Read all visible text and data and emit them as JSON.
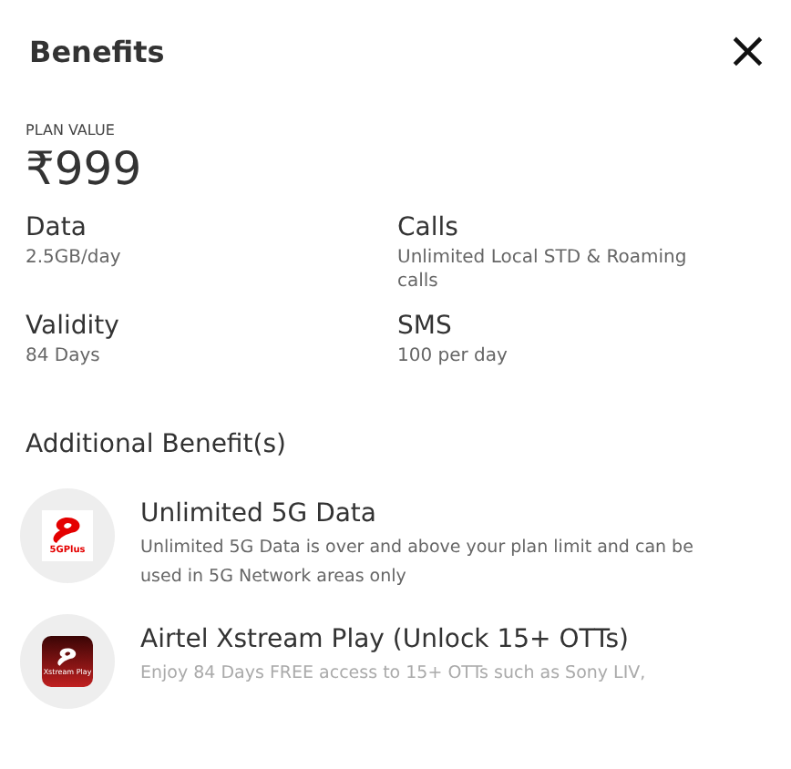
{
  "header": {
    "title": "Benefits",
    "close": "×"
  },
  "plan": {
    "label": "PLAN VALUE",
    "price": "₹999"
  },
  "details": [
    {
      "name": "Data",
      "value": "2.5GB/day"
    },
    {
      "name": "Calls",
      "value": "Unlimited Local STD & Roaming calls"
    },
    {
      "name": "Validity",
      "value": "84 Days"
    },
    {
      "name": "SMS",
      "value": "100 per day"
    }
  ],
  "additional": {
    "heading": "Additional Benefit(s)",
    "items": [
      {
        "kind": "fiveg",
        "badge": "5GPlus",
        "title": "Unlimited 5G Data",
        "description": "Unlimited 5G Data is over and above your plan limit and can be used in 5G Network areas only"
      },
      {
        "kind": "xstream",
        "badge": "Xstream Play",
        "title": "Airtel Xstream Play (Unlock 15+ OTTs)",
        "description": "Enjoy 84 Days FREE access to 15+ OTTs such as Sony LIV,"
      }
    ]
  }
}
